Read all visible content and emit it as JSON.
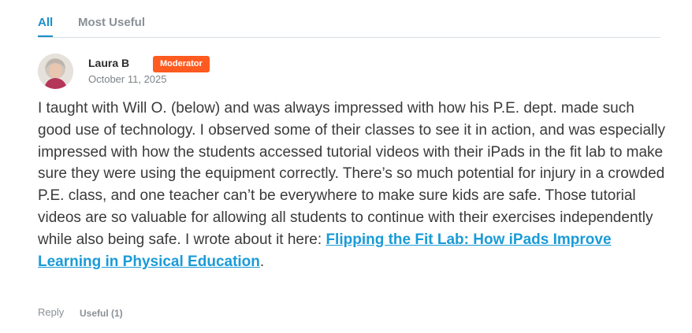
{
  "tabs": [
    {
      "label": "All",
      "active": true
    },
    {
      "label": "Most Useful",
      "active": false
    }
  ],
  "comment": {
    "author": "Laura B",
    "badge": "Moderator",
    "date": "October 11, 2025",
    "text_before_link": "I taught with Will O. (below) and was always impressed with how his P.E. dept. made such good use of technology. I observed some of their classes to see it in action, and was especially impressed with how the students accessed tutorial videos with their iPads in the fit lab to make sure they were using the equipment correctly. There’s so much potential for injury in a crowded P.E. class, and one teacher can’t be everywhere to make sure kids are safe. Those tutorial videos are so valuable for allowing all students to continue with their exercises independently while also being safe. I wrote about it here: ",
    "link_text": "Flipping the Fit Lab: How iPads Improve Learning in Physical Education",
    "text_after_link": "."
  },
  "actions": {
    "reply": "Reply",
    "useful": "Useful (1)"
  },
  "colors": {
    "accent": "#1b8fc9",
    "badge": "#ff5a1f",
    "link": "#1a9bd7"
  }
}
